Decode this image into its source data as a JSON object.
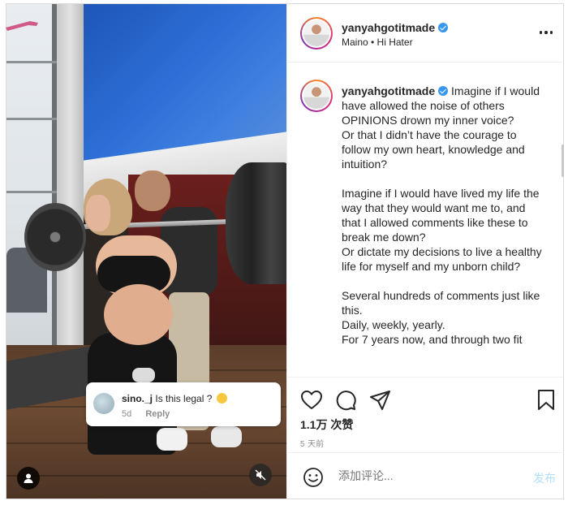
{
  "post": {
    "username": "yanyahgotitmade",
    "audio": "Maino • Hi Hater",
    "caption": {
      "paragraphs": [
        "Imagine if I would have allowed the noise of others OPINIONS drown my inner voice?\nOr that I didn’t have the courage to follow my own heart, knowledge and intuition?",
        "Imagine if I would have lived my life the way that they would want me to, and that I allowed comments like these to break me down?\nOr dictate my decisions to live a healthy life for myself and my unborn child?",
        "Several hundreds of comments just like this.\nDaily, weekly, yearly.\nFor 7 years now, and through two fit"
      ]
    },
    "likes": "1.1万 次赞",
    "time": "5 天前"
  },
  "overlay_comment": {
    "user": "sino._j",
    "text": "Is this legal ?",
    "age": "5d",
    "reply_label": "Reply"
  },
  "add_comment": {
    "placeholder": "添加评论...",
    "post_label": "发布"
  },
  "icons": {
    "header_more": "more-horizontal-icon",
    "like": "heart-icon",
    "comment": "comment-icon",
    "share": "send-icon",
    "save": "bookmark-icon",
    "emoji": "emoji-icon",
    "user_tag": "user-tag-icon",
    "mute": "mute-icon",
    "verified": "verified-badge-icon"
  },
  "colors": {
    "verified": "#3897f0",
    "post_button": "#b2dffc",
    "secondary_text": "#8e8e8e",
    "primary_text": "#262626",
    "border": "#dbdbdb"
  }
}
